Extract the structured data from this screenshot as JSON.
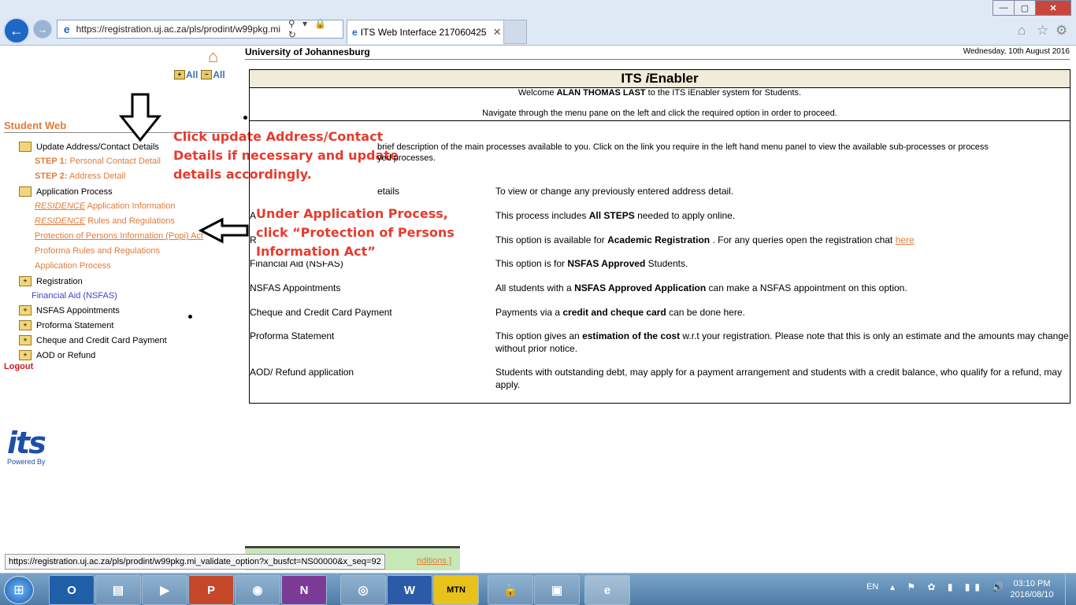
{
  "browser": {
    "url": "https://registration.uj.ac.za/pls/prodint/w99pkg.mi",
    "tab_title": "ITS Web Interface 217060425",
    "addr_tools": "⚲ ▾ 🔒 ↻",
    "tab_close": "✕",
    "win_min": "—",
    "win_max": "▢",
    "win_close": "✕"
  },
  "menu": {
    "expand_all": "All",
    "collapse_all": "All",
    "section_title": "Student Web",
    "items": [
      {
        "label": "Update Address/Contact Details"
      },
      {
        "label": "Application Process"
      },
      {
        "label": "Registration"
      },
      {
        "label": "NSFAS Appointments"
      },
      {
        "label": "Proforma Statement"
      },
      {
        "label": "Cheque and Credit Card Payment"
      },
      {
        "label": "AOD or Refund"
      }
    ],
    "update_subs": {
      "step1_prefix": "STEP 1:",
      "step1_label": "Personal Contact Detail",
      "step2_prefix": "STEP 2:",
      "step2_label": "Address Detail"
    },
    "application_subs": {
      "residence_word": "RESIDENCE",
      "res_info": "Application Information",
      "res_rules": "Rules and Regulations",
      "popi": "Protection of Persons Information (Popi) Act",
      "proforma_rules": "Proforma Rules and Regulations",
      "app_process": "Application Process"
    },
    "financial_aid": "Financial Aid (NSFAS)",
    "logout": "Logout",
    "logo_text": "its",
    "logo_caption": "Powered By"
  },
  "annotations": {
    "top": [
      "Click update Address/Contact",
      "Details if necessary and update",
      "details accordingly."
    ],
    "mid": [
      "Under Application Process,",
      "click “Protection of Persons",
      "Information Act”"
    ]
  },
  "main": {
    "university": "University of Johannesburg",
    "date": "Wednesday, 10th August 2016",
    "title_prefix": "ITS ",
    "title_i": "i",
    "title_suffix": "Enabler",
    "welcome_pre": "Welcome ",
    "welcome_name": "ALAN THOMAS LAST",
    "welcome_post": " to the ITS iEnabler system for Students.",
    "navigate": "Navigate through the menu pane on the left and click the required option in order to proceed.",
    "intro": "brief description of the main processes available to you. Click on the link you require in the left hand menu panel to view the available sub-processes or process",
    "intro2": "yed processes.",
    "rows": [
      {
        "left": "etails",
        "pre": "To view or change any previously entered address detail.",
        "bold": "",
        "post": ""
      },
      {
        "left": "A",
        "pre": "This process includes ",
        "bold": "All STEPS",
        "post": " needed to apply online."
      },
      {
        "left": "R",
        "pre": "This option is available for ",
        "bold": "Academic Registration",
        "post": " . For any queries open the registration chat ",
        "link": "here"
      },
      {
        "left": "Financial Aid (NSFAS)",
        "pre": "This option is for ",
        "bold": "NSFAS Approved",
        "post": " Students."
      },
      {
        "left": "NSFAS Appointments",
        "pre": "All students with a ",
        "bold": "NSFAS Approved Application",
        "post": " can make a NSFAS appointment on this option."
      },
      {
        "left": "Cheque and Credit Card Payment",
        "pre": "Payments via a ",
        "bold": "credit and cheque card",
        "post": " can be done here."
      },
      {
        "left": "Proforma Statement",
        "pre": "This option gives an ",
        "bold": "estimation of the cost",
        "post": " w.r.t your registration. Please note that this is only an estimate and the amounts may change without prior notice."
      },
      {
        "left": "AOD/ Refund application",
        "pre": "Students with outstanding debt, may apply for a payment arrangement and students with a credit balance, who qualify for a refund, may apply.",
        "bold": "",
        "post": ""
      }
    ]
  },
  "status": {
    "url": "https://registration.uj.ac.za/pls/prodint/w99pkg.mi_validate_option?x_busfct=NS00000&x_seq=92",
    "conditions": "nditions ]"
  },
  "taskbar": {
    "apps": [
      "O",
      "▤",
      "▶",
      "P",
      "◉",
      "N",
      "◎",
      "W",
      "MTN",
      "🔒",
      "▣",
      "e"
    ],
    "lang": "EN",
    "tray": "▴ ⚑ ✿ ▮ ▮▮ 🔊",
    "time": "03:10 PM",
    "date": "2016/08/10"
  }
}
